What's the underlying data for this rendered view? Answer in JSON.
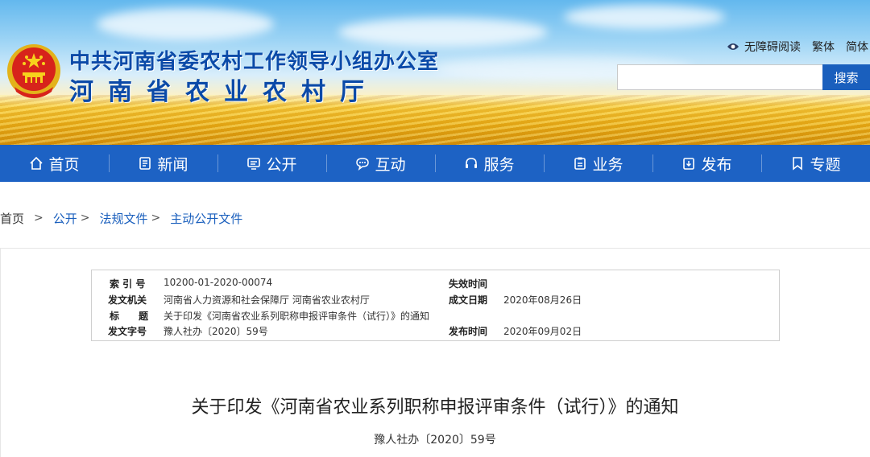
{
  "header": {
    "title_line1": "中共河南省委农村工作领导小组办公室",
    "title_line2": "河南省农业农村厅",
    "links": {
      "accessible": "无障碍阅读",
      "traditional": "繁体",
      "simplified": "简体"
    },
    "search": {
      "placeholder": "",
      "button_label": "搜索"
    }
  },
  "nav": {
    "items": [
      {
        "label": "首页",
        "icon": "home-icon"
      },
      {
        "label": "新闻",
        "icon": "news-icon"
      },
      {
        "label": "公开",
        "icon": "monitor-icon"
      },
      {
        "label": "互动",
        "icon": "chat-icon"
      },
      {
        "label": "服务",
        "icon": "headset-icon"
      },
      {
        "label": "业务",
        "icon": "clipboard-icon"
      },
      {
        "label": "发布",
        "icon": "publish-icon"
      },
      {
        "label": "专题",
        "icon": "bookmark-icon"
      }
    ]
  },
  "breadcrumb": {
    "items": [
      "首页",
      "公开",
      "法规文件",
      "主动公开文件"
    ],
    "separator": ">"
  },
  "meta": {
    "index_label": "索 引 号",
    "index_value": "10200-01-2020-00074",
    "issuer_label": "发文机关",
    "issuer_value": "河南省人力资源和社会保障厅 河南省农业农村厅",
    "title_label": "标　　题",
    "title_value": "关于印发《河南省农业系列职称申报评审条件（试行）》的通知",
    "docnum_label": "发文字号",
    "docnum_value": "豫人社办〔2020〕59号",
    "expire_label": "失效时间",
    "expire_value": "",
    "created_label": "成文日期",
    "created_value": "2020年08月26日",
    "published_label": "发布时间",
    "published_value": "2020年09月02日"
  },
  "document": {
    "title": "关于印发《河南省农业系列职称申报评审条件（试行）》的通知",
    "number": "豫人社办〔2020〕59号"
  },
  "colors": {
    "nav_bg": "#1d62c4",
    "title_blue": "#0b4aa8",
    "link_blue": "#1a5fbd"
  }
}
